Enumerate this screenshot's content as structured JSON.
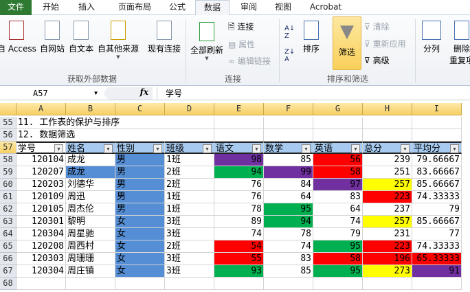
{
  "tabs": [
    "文件",
    "开始",
    "插入",
    "页面布局",
    "公式",
    "数据",
    "审阅",
    "视图",
    "Acrobat"
  ],
  "active_tab": "数据",
  "ribbon": {
    "get_external": {
      "label": "获取外部数据",
      "buttons": [
        "自 Access",
        "自网站",
        "自文本",
        "自其他来源",
        "现有连接"
      ]
    },
    "connections": {
      "label": "连接",
      "refresh": "全部刷新",
      "connections": "连接",
      "properties": "属性",
      "edit_links": "编辑链接"
    },
    "sort_filter": {
      "label": "排序和筛选",
      "sort": "排序",
      "filter": "筛选",
      "clear": "清除",
      "reapply": "重新应用",
      "advanced": "高级"
    },
    "tools": {
      "split": "分列",
      "remove_dup_1": "删除",
      "remove_dup_2": "重复项"
    }
  },
  "formula_bar": {
    "name_box": "A57",
    "fx": "fx",
    "value": "学号"
  },
  "columns": [
    "A",
    "B",
    "C",
    "D",
    "E",
    "F",
    "G",
    "H",
    "I"
  ],
  "colors": {
    "p": "#7030a0",
    "g": "#00b050",
    "r": "#ff0000",
    "y": "#ffff00",
    "b": "#558ed5",
    "header": "#a6caf0"
  },
  "text_rows": [
    {
      "row": "55",
      "text": "11.  工作表的保护与排序"
    },
    {
      "row": "56",
      "text": "12.  数据筛选"
    }
  ],
  "header_row": {
    "row": "57",
    "cells": [
      "学号",
      "姓名",
      "性别",
      "班级",
      "语文",
      "数学",
      "英语",
      "总分",
      "平均分"
    ]
  },
  "rows": [
    {
      "row": "58",
      "cells": [
        "120104",
        "成龙",
        "男",
        "1班",
        "98",
        "85",
        "56",
        "239",
        "79.66667"
      ],
      "fill": [
        "",
        "",
        "b",
        "",
        "p",
        "",
        "r",
        "",
        ""
      ]
    },
    {
      "row": "59",
      "cells": [
        "120207",
        "成龙",
        "男",
        "2班",
        "94",
        "99",
        "58",
        "251",
        "83.66667"
      ],
      "fill": [
        "",
        "b",
        "b",
        "",
        "g",
        "p",
        "r",
        "",
        ""
      ]
    },
    {
      "row": "60",
      "cells": [
        "120203",
        "刘德华",
        "男",
        "2班",
        "76",
        "84",
        "97",
        "257",
        "85.66667"
      ],
      "fill": [
        "",
        "",
        "b",
        "",
        "",
        "",
        "p",
        "y",
        ""
      ]
    },
    {
      "row": "61",
      "cells": [
        "120109",
        "周迅",
        "男",
        "1班",
        "76",
        "64",
        "83",
        "223",
        "74.33333"
      ],
      "fill": [
        "",
        "",
        "b",
        "",
        "",
        "",
        "",
        "r",
        ""
      ]
    },
    {
      "row": "62",
      "cells": [
        "120105",
        "周杰伦",
        "男",
        "1班",
        "78",
        "95",
        "64",
        "237",
        "79"
      ],
      "fill": [
        "",
        "",
        "b",
        "",
        "",
        "g",
        "",
        "",
        ""
      ]
    },
    {
      "row": "63",
      "cells": [
        "120301",
        "黎明",
        "女",
        "3班",
        "89",
        "94",
        "74",
        "257",
        "85.66667"
      ],
      "fill": [
        "",
        "",
        "b",
        "",
        "",
        "g",
        "",
        "y",
        ""
      ]
    },
    {
      "row": "64",
      "cells": [
        "120304",
        "周星驰",
        "女",
        "3班",
        "74",
        "78",
        "79",
        "231",
        "77"
      ],
      "fill": [
        "",
        "",
        "b",
        "",
        "",
        "",
        "",
        "",
        ""
      ]
    },
    {
      "row": "65",
      "cells": [
        "120208",
        "周西村",
        "女",
        "2班",
        "54",
        "74",
        "95",
        "223",
        "74.33333"
      ],
      "fill": [
        "",
        "",
        "b",
        "",
        "r",
        "",
        "g",
        "r",
        ""
      ]
    },
    {
      "row": "66",
      "cells": [
        "120303",
        "周珊珊",
        "女",
        "3班",
        "55",
        "83",
        "58",
        "196",
        "65.33333"
      ],
      "fill": [
        "",
        "",
        "b",
        "",
        "r",
        "",
        "r",
        "r",
        "r"
      ]
    },
    {
      "row": "67",
      "cells": [
        "120304",
        "周庄镇",
        "女",
        "3班",
        "93",
        "85",
        "95",
        "273",
        "91"
      ],
      "fill": [
        "",
        "",
        "b",
        "",
        "g",
        "",
        "g",
        "y",
        "p"
      ]
    }
  ],
  "empty_rows": [
    "68"
  ]
}
